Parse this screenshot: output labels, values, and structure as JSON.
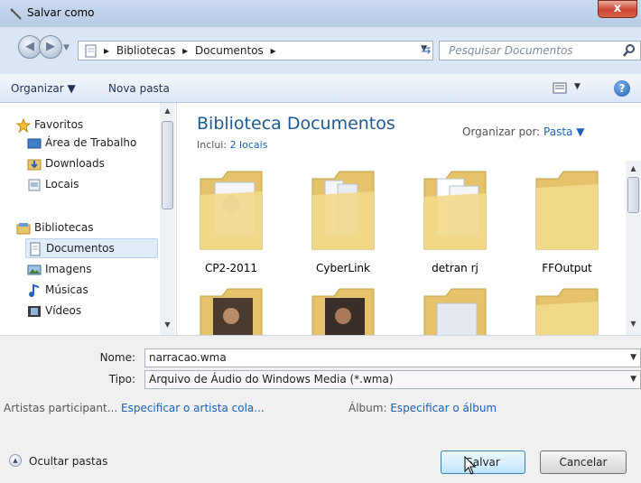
{
  "window": {
    "title": "Salvar como",
    "close_glyph": "x"
  },
  "address": {
    "crumbs": [
      "Bibliotecas",
      "Documentos"
    ]
  },
  "search": {
    "placeholder": "Pesquisar Documentos"
  },
  "toolbar": {
    "organize": "Organizar ▼",
    "new_folder": "Nova pasta"
  },
  "nav": {
    "favorites": "Favoritos",
    "desktop": "Área de Trabalho",
    "downloads": "Downloads",
    "places": "Locais",
    "libraries": "Bibliotecas",
    "documents": "Documentos",
    "images": "Imagens",
    "music": "Músicas",
    "videos": "Vídeos"
  },
  "library": {
    "title": "Biblioteca Documentos",
    "includes_label": "Inclui:",
    "includes_link": "2 locais",
    "arrange_label": "Organizar por:",
    "arrange_value": "Pasta ▼"
  },
  "folders": [
    "CP2-2011",
    "CyberLink",
    "detran rj",
    "FFOutput"
  ],
  "form": {
    "name_label": "Nome:",
    "name_value": "narracao.wma",
    "type_label": "Tipo:",
    "type_value": "Arquivo de Áudio do Windows Media (*.wma)",
    "artists_label": "Artistas participant...",
    "artists_link": "Especificar o artista cola...",
    "album_label": "Álbum:",
    "album_link": "Especificar o álbum"
  },
  "buttons": {
    "hide_folders": "Ocultar pastas",
    "save": "Salvar",
    "cancel": "Cancelar"
  },
  "colors": {
    "title_blue": "#1e5a96",
    "link": "#1b62b8",
    "selection": "#e1ecfa"
  }
}
